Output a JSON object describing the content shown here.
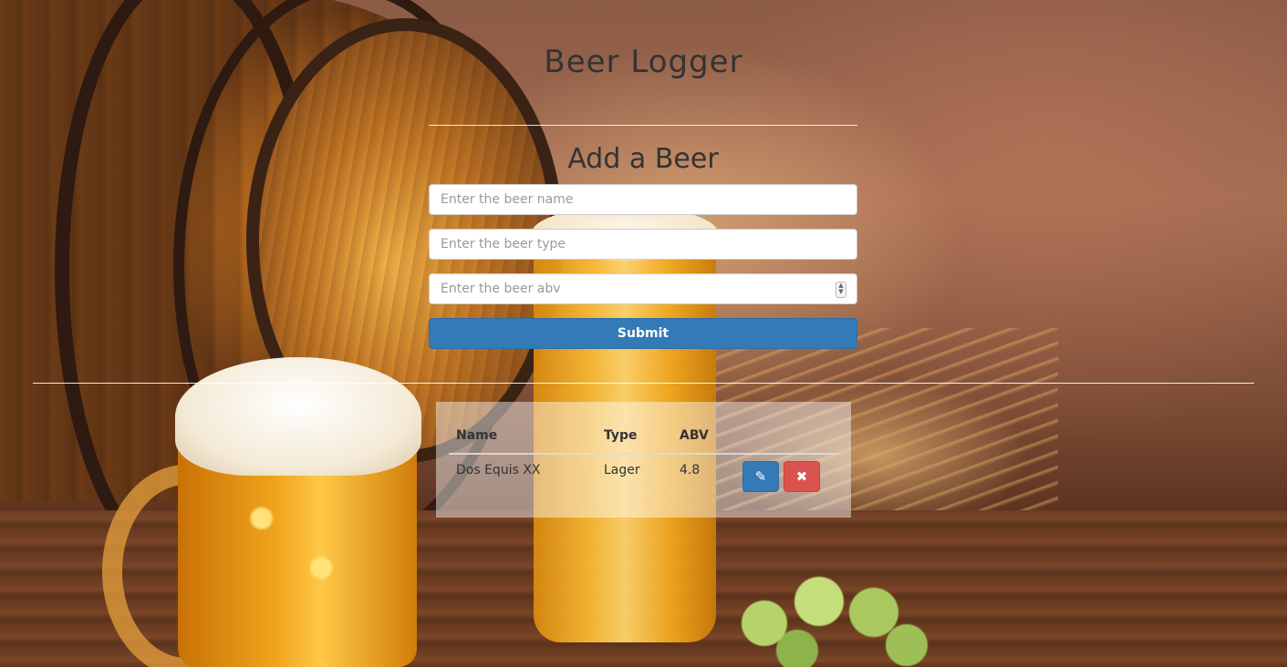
{
  "app": {
    "title": "Beer Logger"
  },
  "form": {
    "title": "Add a Beer",
    "name_placeholder": "Enter the beer name",
    "type_placeholder": "Enter the beer type",
    "abv_placeholder": "Enter the beer abv",
    "submit_label": "Submit"
  },
  "beer_table": {
    "headers": {
      "name": "Name",
      "type": "Type",
      "abv": "ABV"
    },
    "rows": [
      {
        "name": "Dos Equis XX",
        "type": "Lager",
        "abv": "4.8"
      }
    ]
  },
  "icons": {
    "edit": "pencil-icon",
    "delete": "close-icon",
    "spinner": "number-spinner-icon"
  },
  "colors": {
    "primary": "#337ab7",
    "danger": "#d9534f",
    "text": "#333333"
  }
}
